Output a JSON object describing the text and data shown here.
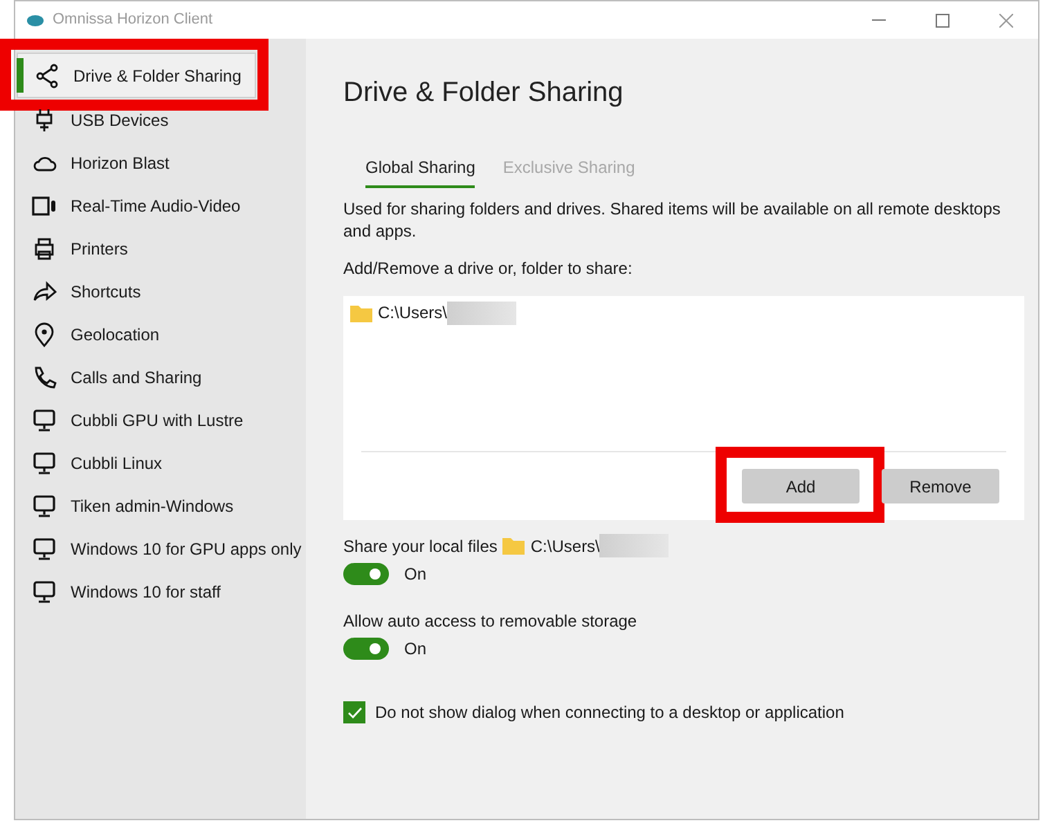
{
  "window": {
    "title": "Omnissa Horizon Client"
  },
  "sidebar": {
    "items": [
      {
        "label": "Drive & Folder Sharing",
        "kind": "share",
        "selected": true,
        "highlighted": true
      },
      {
        "label": "USB Devices",
        "kind": "plug",
        "selected": false,
        "highlighted": false
      },
      {
        "label": "Horizon Blast",
        "kind": "cloud",
        "selected": false,
        "highlighted": false
      },
      {
        "label": "Real-Time Audio-Video",
        "kind": "camera",
        "selected": false,
        "highlighted": false
      },
      {
        "label": "Printers",
        "kind": "printer",
        "selected": false,
        "highlighted": false
      },
      {
        "label": "Shortcuts",
        "kind": "arrow",
        "selected": false,
        "highlighted": false
      },
      {
        "label": "Geolocation",
        "kind": "pin",
        "selected": false,
        "highlighted": false
      },
      {
        "label": "Calls and Sharing",
        "kind": "phone",
        "selected": false,
        "highlighted": false
      },
      {
        "label": "Cubbli GPU with Lustre",
        "kind": "desktop",
        "selected": false,
        "highlighted": false
      },
      {
        "label": "Cubbli Linux",
        "kind": "desktop",
        "selected": false,
        "highlighted": false
      },
      {
        "label": "Tiken admin-Windows",
        "kind": "desktop",
        "selected": false,
        "highlighted": false
      },
      {
        "label": "Windows 10 for GPU apps only",
        "kind": "desktop",
        "selected": false,
        "highlighted": false
      },
      {
        "label": "Windows 10 for staff",
        "kind": "desktop",
        "selected": false,
        "highlighted": false
      }
    ]
  },
  "page": {
    "title": "Drive & Folder Sharing",
    "tabs": [
      {
        "label": "Global Sharing",
        "selected": true
      },
      {
        "label": "Exclusive Sharing",
        "selected": false
      }
    ],
    "description": "Used for sharing folders and drives. Shared items will be available on all remote desktops and apps.",
    "list_label": "Add/Remove a drive or, folder to share:",
    "shared_items": [
      {
        "path": "C:\\Users\\",
        "redacted": true
      }
    ],
    "buttons": [
      {
        "label": "Add",
        "highlighted": true
      },
      {
        "label": "Remove",
        "highlighted": false
      }
    ],
    "settings": [
      {
        "label": "Share your local files",
        "path": "C:\\Users\\",
        "redacted": true,
        "on": true,
        "state_text": "On"
      },
      {
        "label": "Allow auto access to removable storage",
        "on": true,
        "state_text": "On"
      }
    ],
    "checkbox": {
      "label": "Do not show dialog when connecting to a desktop or application",
      "checked": true
    }
  }
}
